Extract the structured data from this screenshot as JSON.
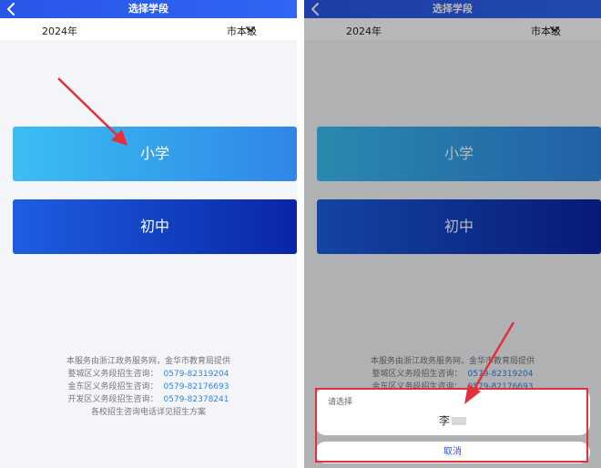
{
  "header": {
    "title": "选择学段"
  },
  "filters": {
    "year": "2024年",
    "level": "市本级"
  },
  "buttons": {
    "primary": "小学",
    "middle": "初中"
  },
  "footer": {
    "line1": "本服务由浙江政务服务网，金华市教育局提供",
    "districts": [
      {
        "name": "婺城区义务段招生咨询：",
        "phone": "0579-82319204"
      },
      {
        "name": "金东区义务段招生咨询：",
        "phone": "0579-82176693"
      },
      {
        "name": "开发区义务段招生咨询：",
        "phone": "0579-82378241"
      }
    ],
    "line5": "各校招生咨询电话详见招生方案"
  },
  "sheet": {
    "title": "请选择",
    "option_text": "李",
    "cancel": "取消"
  },
  "colors": {
    "header": "#2a56e8",
    "primary_button_start": "#3bbef3",
    "primary_button_end": "#2f86e6",
    "middle_button_start": "#1d5fe2",
    "middle_button_end": "#0a25a6",
    "annotation": "#e2313b",
    "link": "#2f86e6"
  }
}
